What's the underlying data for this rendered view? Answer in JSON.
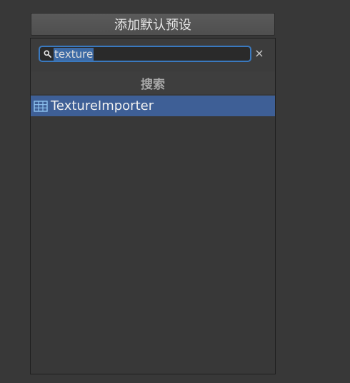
{
  "header": {
    "button_label": "添加默认预设"
  },
  "search": {
    "value": "texture",
    "search_icon": "search-icon",
    "clear_icon": "close-icon",
    "clear_symbol": "×"
  },
  "results": {
    "section_title": "搜索",
    "items": [
      {
        "label": "TextureImporter",
        "icon": "grid-icon",
        "selected": true
      }
    ]
  },
  "colors": {
    "background": "#383838",
    "selection": "#3e5f96",
    "focus_border": "#3a79bf",
    "text_highlight": "#3d6aa5"
  }
}
